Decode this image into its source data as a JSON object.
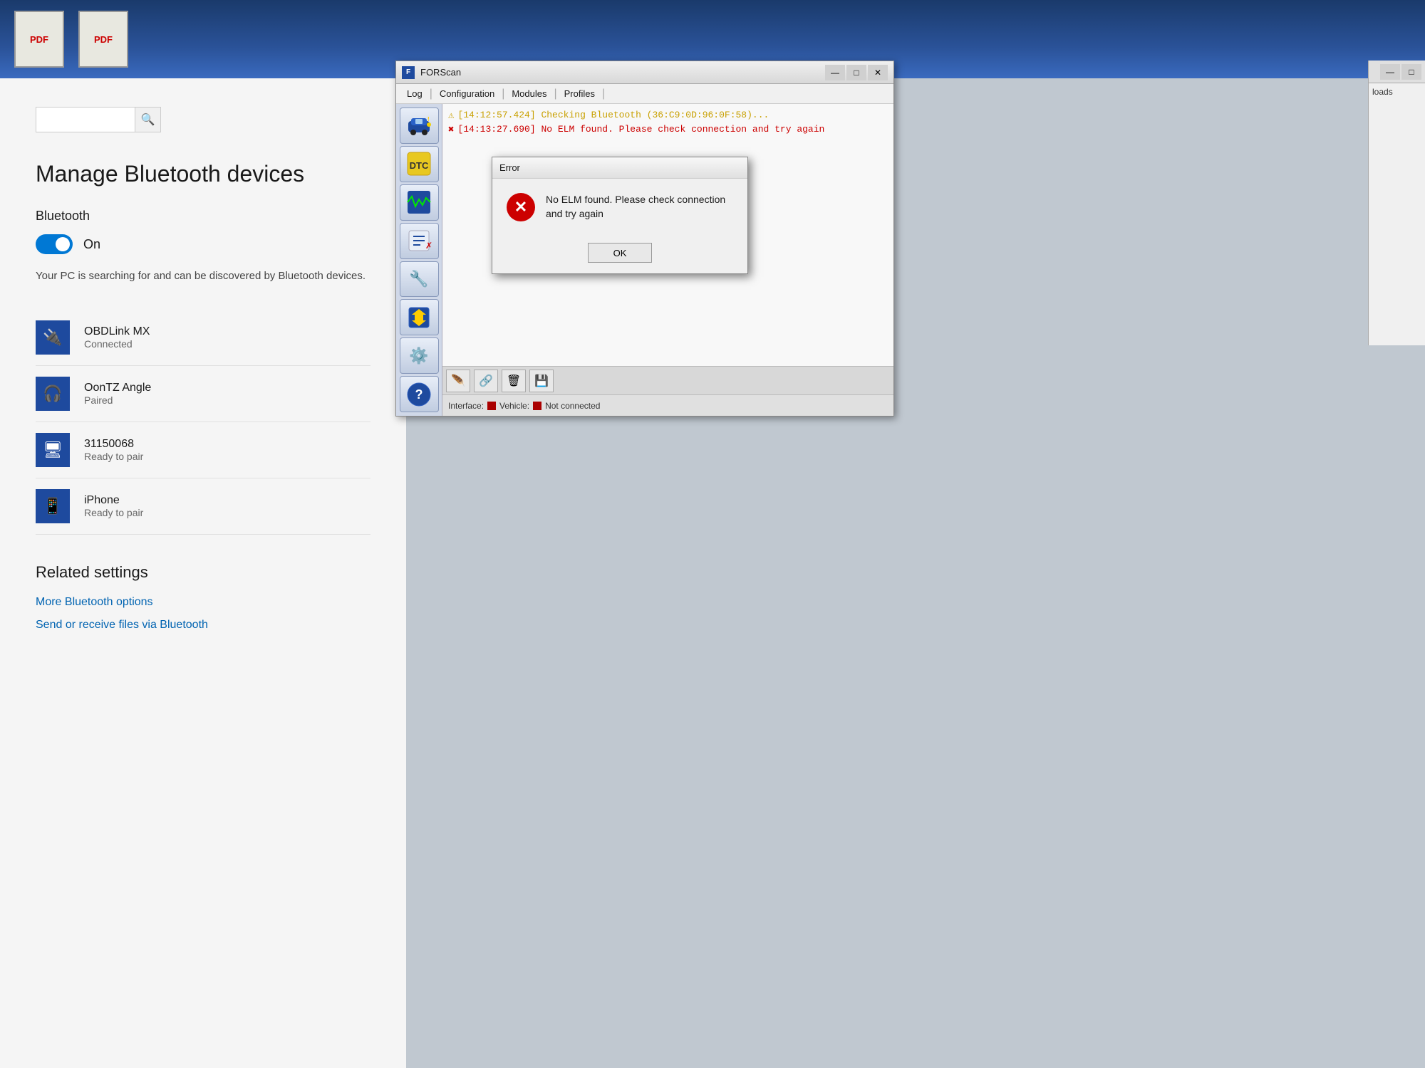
{
  "topbar": {
    "pdf_icon1_label": "PDF",
    "pdf_icon2_label": "PDF"
  },
  "settings": {
    "page_title": "Manage Bluetooth devices",
    "bluetooth_label": "Bluetooth",
    "toggle_state": "On",
    "description": "Your PC is searching for and can be discovered by Bluetooth devices.",
    "devices": [
      {
        "name": "OBDLink MX",
        "status": "Connected",
        "icon": "🔌"
      },
      {
        "name": "OonTZ Angle",
        "status": "Paired",
        "icon": "🎧"
      },
      {
        "name": "31150068",
        "status": "Ready to pair",
        "icon": "🖥"
      },
      {
        "name": "iPhone",
        "status": "Ready to pair",
        "icon": "📱"
      }
    ],
    "related_settings_title": "Related settings",
    "related_links": [
      "More Bluetooth options",
      "Send or receive files via Bluetooth"
    ]
  },
  "forscan": {
    "title": "FORScan",
    "menu": [
      "Log",
      "Configuration",
      "Modules",
      "Profiles"
    ],
    "log_lines": [
      {
        "type": "warn",
        "text": "[14:12:57.424] Checking Bluetooth (36:C9:0D:96:0F:58)..."
      },
      {
        "type": "error",
        "text": "[14:13:27.690] No ELM found. Please check connection and try again"
      }
    ],
    "status": {
      "interface_label": "Interface:",
      "vehicle_label": "Vehicle:",
      "not_connected_label": "Not connected"
    }
  },
  "error_dialog": {
    "title": "Error",
    "message": "No ELM found. Please check connection and try again",
    "ok_button": "OK"
  },
  "downloads_label": "loads"
}
